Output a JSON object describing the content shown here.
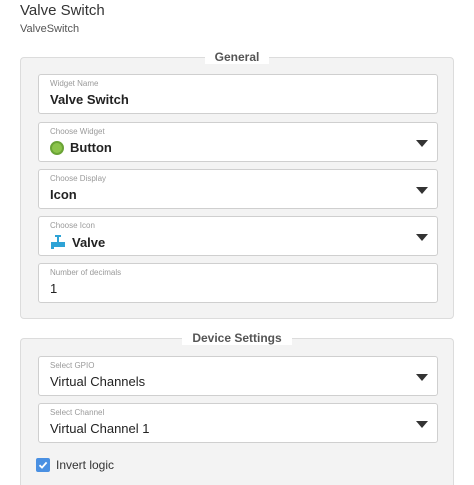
{
  "header": {
    "title": "Valve Switch",
    "subtitle": "ValveSwitch"
  },
  "general": {
    "legend": "General",
    "fields": {
      "widget_name": {
        "label": "Widget Name",
        "value": "Valve Switch"
      },
      "choose_widget": {
        "label": "Choose Widget",
        "value": "Button",
        "icon": "button-icon"
      },
      "choose_display": {
        "label": "Choose Display",
        "value": "Icon"
      },
      "choose_icon": {
        "label": "Choose Icon",
        "value": "Valve",
        "icon": "valve-icon"
      },
      "decimals": {
        "label": "Number of decimals",
        "value": "1"
      }
    }
  },
  "device": {
    "legend": "Device Settings",
    "fields": {
      "gpio": {
        "label": "Select GPIO",
        "value": "Virtual Channels"
      },
      "channel": {
        "label": "Select Channel",
        "value": "Virtual Channel 1"
      }
    },
    "invert_logic": {
      "label": "Invert logic",
      "checked": true
    }
  },
  "colors": {
    "accent": "#4a90e2",
    "button_green": "#8bc34a",
    "valve_blue": "#2ea3d6"
  }
}
